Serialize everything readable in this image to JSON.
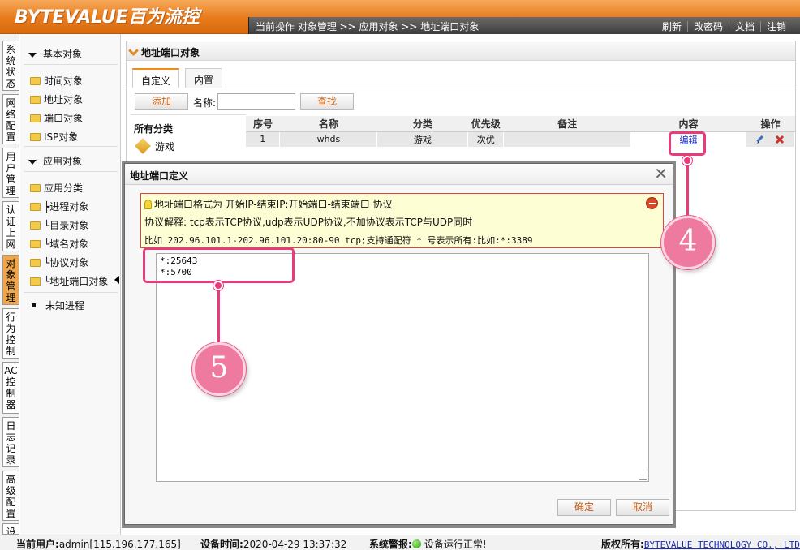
{
  "header": {
    "logo": "BYTEVALUE百为流控",
    "breadcrumb": "当前操作  对象管理 >> 应用对象 >> 地址端口对象",
    "links": [
      "刷新",
      "改密码",
      "文档",
      "注销"
    ]
  },
  "side_tabs": [
    "系统状态",
    "网络配置",
    "用户管理",
    "认证上网",
    "对象管理",
    "行为控制",
    "AC控制器",
    "日志记录",
    "高级配置",
    "设"
  ],
  "nav": {
    "basic_header": "基本对象",
    "basic_items": [
      "时间对象",
      "地址对象",
      "端口对象",
      "ISP对象"
    ],
    "app_header": "应用对象",
    "app_items": [
      "应用分类",
      "┝进程对象",
      "└目录对象",
      "└域名对象",
      "└协议对象",
      "└地址端口对象"
    ],
    "unknown": "未知进程"
  },
  "panel": {
    "title": "地址端口对象",
    "tabs": [
      "自定义",
      "内置"
    ],
    "add_button": "添加",
    "name_label": "名称:",
    "name_value": "",
    "search_button": "查找",
    "category_header": "所有分类",
    "category_game": "游戏",
    "table": {
      "headers": [
        "序号",
        "名称",
        "分类",
        "优先级",
        "备注",
        "内容",
        "操作"
      ],
      "rows": [
        {
          "index": "1",
          "name": "whds",
          "category": "游戏",
          "priority": "次优",
          "note": "",
          "content": "编辑"
        }
      ]
    }
  },
  "dialog": {
    "title": "地址端口定义",
    "close": "✕",
    "notice_line1": "地址端口格式为 开始IP-结束IP:开始端口-结束端口 协议",
    "notice_line2": "协议解释: tcp表示TCP协议,udp表示UDP协议,不加协议表示TCP与UDP同时",
    "notice_line3": "比如 202.96.101.1-202.96.101.20:80-90 tcp;支持通配符 * 号表示所有:比如:*:3389",
    "ports_text": "*:25643\n*:5700",
    "ok_button": "确定",
    "cancel_button": "取消"
  },
  "callouts": {
    "c4": "4",
    "c5": "5",
    "color": "#e93b7c"
  },
  "status": {
    "user_label": "当前用户:",
    "user_value": "admin[115.196.177.165]",
    "time_label": "设备时间:",
    "time_value": "2020-04-29 13:37:32",
    "alarm_label": "系统警报:",
    "alarm_value": "设备运行正常!",
    "copyright_label": "版权所有:",
    "copyright_value": "BYTEVALUE TECHNOLOGY CO., LTD"
  }
}
